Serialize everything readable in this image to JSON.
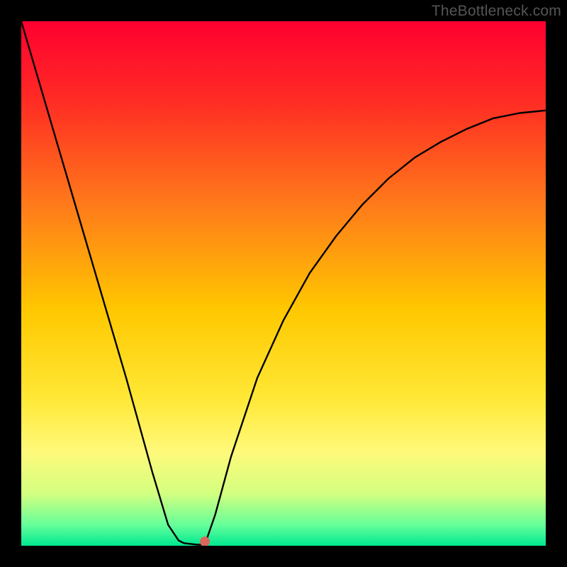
{
  "watermark": "TheBottleneck.com",
  "chart_data": {
    "type": "line",
    "title": "",
    "xlabel": "",
    "ylabel": "",
    "xlim": [
      0,
      1
    ],
    "ylim": [
      0,
      1
    ],
    "note": "Axis values are not labeled in the source image; x and y are normalized 0..1 estimates from pixel positions.",
    "background_gradient_stops": [
      {
        "pos": 0.0,
        "color": "#ff0030"
      },
      {
        "pos": 0.15,
        "color": "#ff2b24"
      },
      {
        "pos": 0.35,
        "color": "#ff7a1a"
      },
      {
        "pos": 0.55,
        "color": "#ffc800"
      },
      {
        "pos": 0.72,
        "color": "#ffe836"
      },
      {
        "pos": 0.82,
        "color": "#fff97a"
      },
      {
        "pos": 0.9,
        "color": "#d4ff80"
      },
      {
        "pos": 0.96,
        "color": "#66ff9a"
      },
      {
        "pos": 1.0,
        "color": "#00e890"
      }
    ],
    "series": [
      {
        "name": "left-descent",
        "x": [
          0.0,
          0.05,
          0.1,
          0.15,
          0.2,
          0.25,
          0.28,
          0.3,
          0.31
        ],
        "y": [
          1.0,
          0.83,
          0.66,
          0.49,
          0.32,
          0.14,
          0.04,
          0.01,
          0.005
        ]
      },
      {
        "name": "trough-flat",
        "x": [
          0.31,
          0.335,
          0.35
        ],
        "y": [
          0.005,
          0.002,
          0.002
        ]
      },
      {
        "name": "right-rise",
        "x": [
          0.35,
          0.37,
          0.4,
          0.45,
          0.5,
          0.55,
          0.6,
          0.65,
          0.7,
          0.75,
          0.8,
          0.85,
          0.9,
          0.95,
          1.0
        ],
        "y": [
          0.002,
          0.06,
          0.17,
          0.32,
          0.43,
          0.52,
          0.59,
          0.65,
          0.7,
          0.74,
          0.77,
          0.795,
          0.815,
          0.825,
          0.83
        ]
      }
    ],
    "marker": {
      "x": 0.35,
      "y": 0.008,
      "color": "#d9675b",
      "radius_px": 7
    }
  }
}
